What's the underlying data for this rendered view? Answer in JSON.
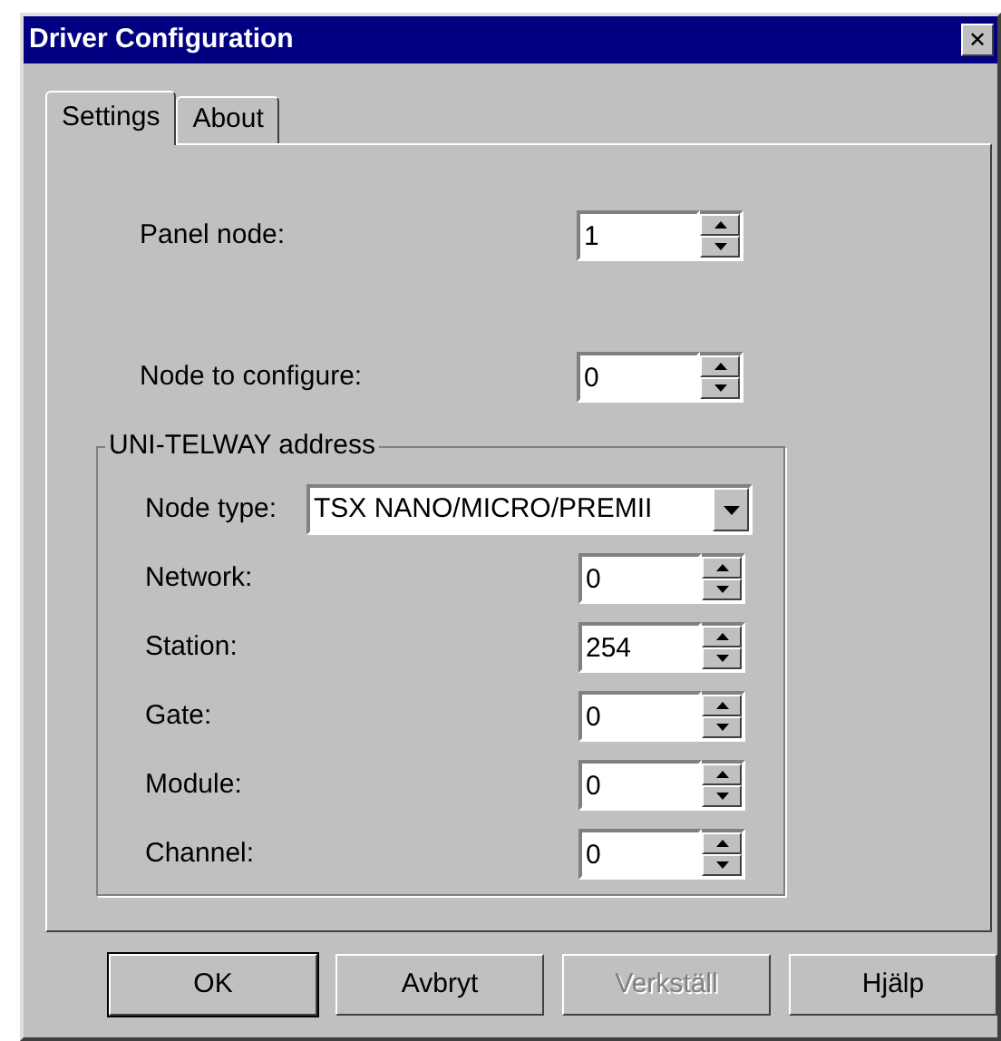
{
  "window": {
    "title": "Driver Configuration",
    "close": "✕"
  },
  "tabs": [
    {
      "label": "Settings",
      "selected": true
    },
    {
      "label": "About",
      "selected": false
    }
  ],
  "fields": [
    {
      "label": "Panel node:",
      "value": "1"
    },
    {
      "label": "Node to configure:",
      "value": "0"
    }
  ],
  "group": {
    "title": "UNI-TELWAY address",
    "node_type": {
      "label": "Node type:",
      "value": "TSX NANO/MICRO/PREMII"
    },
    "fields": [
      {
        "label": "Network:",
        "value": "0"
      },
      {
        "label": "Station:",
        "value": "254"
      },
      {
        "label": "Gate:",
        "value": "0"
      },
      {
        "label": "Module:",
        "value": "0"
      },
      {
        "label": "Channel:",
        "value": "0"
      }
    ]
  },
  "buttons": [
    {
      "label": "OK",
      "disabled": false,
      "default": true
    },
    {
      "label": "Avbryt",
      "disabled": false,
      "default": false
    },
    {
      "label": "Verkställ",
      "disabled": true,
      "default": false
    },
    {
      "label": "Hjälp",
      "disabled": false,
      "default": false
    }
  ]
}
